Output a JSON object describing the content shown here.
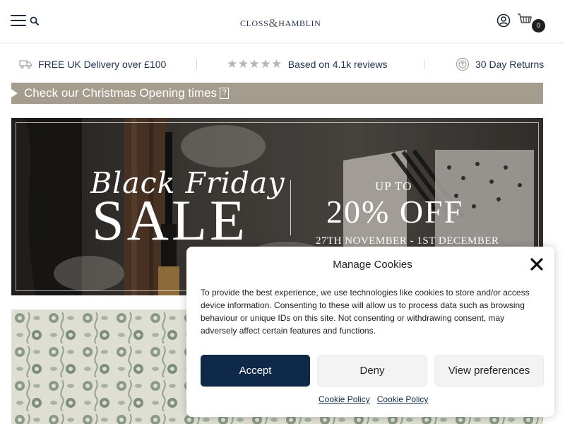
{
  "header": {
    "logo_left": "CLOSS",
    "logo_amp": "&",
    "logo_right": "HAMBLIN",
    "cart_count": "0"
  },
  "usp": {
    "delivery": "FREE UK Delivery over £100",
    "stars": "★★★★★",
    "reviews": "Based on 4.1k reviews",
    "returns": "30 Day Returns"
  },
  "notice": {
    "text": "Check our Christmas Opening times",
    "icon_glyph": "?"
  },
  "banner": {
    "title": "Black Friday",
    "sale": "SALE",
    "upto": "UP TO",
    "discount": "20% OFF",
    "dates": "27TH NOVEMBER - 1ST DECEMBER"
  },
  "cookie": {
    "title": "Manage Cookies",
    "body": "To provide the best experience, we use technologies like cookies to store and/or access device information. Consenting to these will allow us to process data such as browsing behaviour or unique IDs on this site. Not consenting or withdrawing consent, may adversely affect certain features and functions.",
    "accept_label": "Accept",
    "deny_label": "Deny",
    "prefs_label": "View preferences",
    "link1": "Cookie Policy",
    "link2": "Cookie Policy"
  },
  "colors": {
    "brand_navy": "#0f2a48",
    "notice_bar": "#a49d8e"
  },
  "icons": [
    "menu-icon",
    "search-icon",
    "account-icon",
    "cart-icon",
    "delivery-van-icon",
    "returns-icon",
    "close-icon",
    "arrow-right-icon"
  ]
}
